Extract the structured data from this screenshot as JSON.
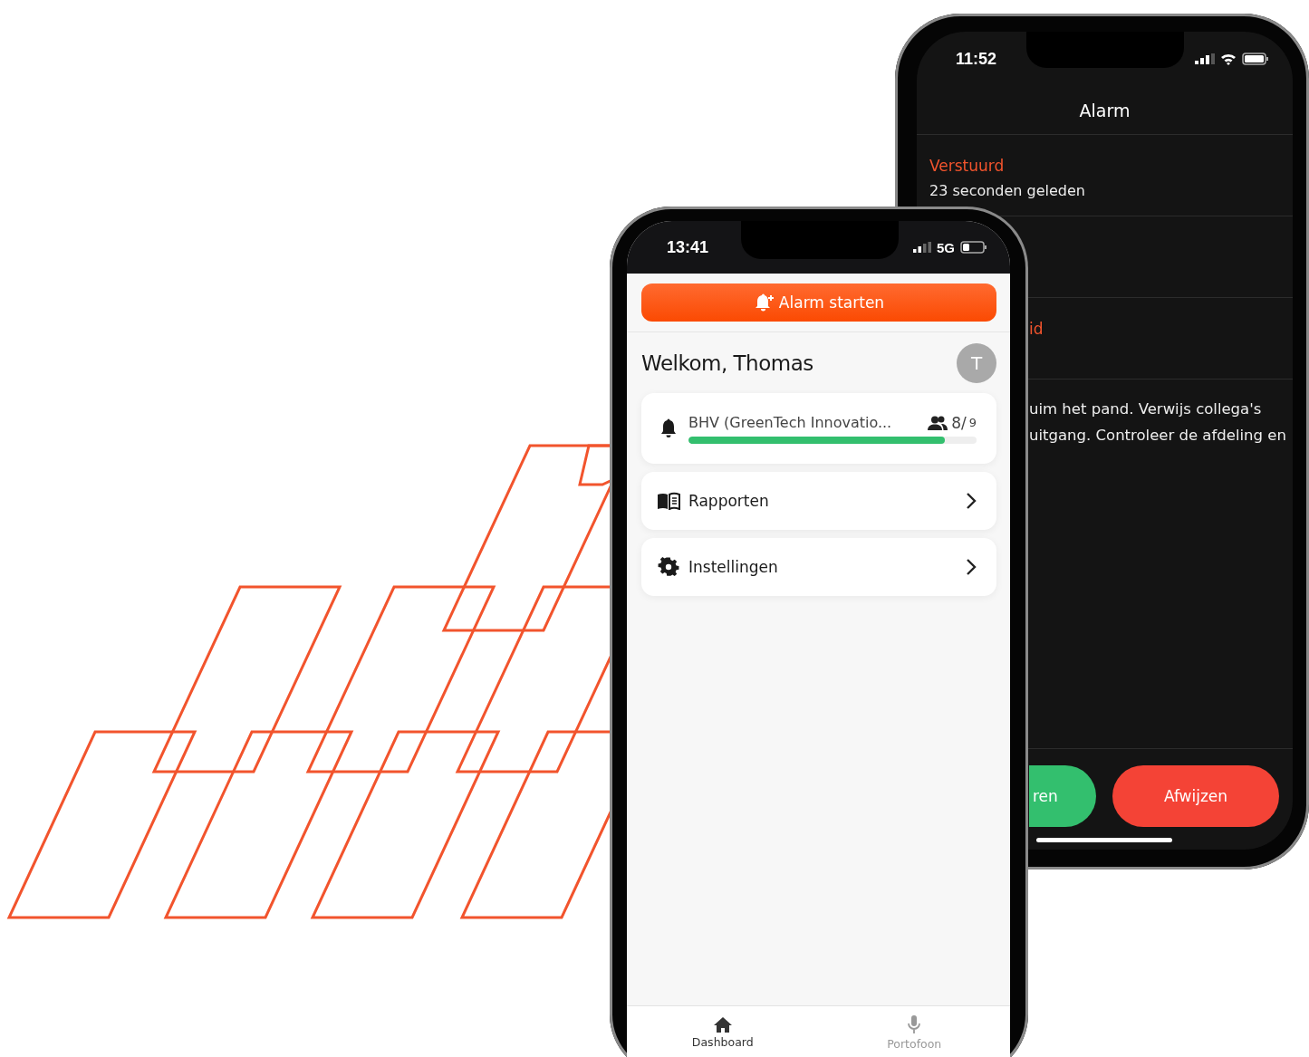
{
  "back_phone": {
    "status_bar": {
      "time": "11:52"
    },
    "title": "Alarm",
    "rows": [
      {
        "label": "Verstuurd",
        "value": "23 seconden geleden"
      },
      {
        "label": "id"
      }
    ],
    "message_lines": [
      "uim het pand. Verwijs collega's",
      "uitgang. Controleer de afdeling en"
    ],
    "buttons": [
      {
        "label": "ren",
        "kind": "accept"
      },
      {
        "label": "Afwijzen",
        "kind": "reject"
      }
    ]
  },
  "front_phone": {
    "status_bar": {
      "time": "13:41",
      "network": "5G"
    },
    "alarm_button": "Alarm starten",
    "welcome": "Welkom, Thomas",
    "avatar": "T",
    "group": {
      "name": "BHV (GreenTech Innovatio...",
      "count": "8/",
      "total": "9",
      "level": 0.89
    },
    "menu": [
      {
        "label": "Rapporten",
        "kind": "reports"
      },
      {
        "label": "Instellingen",
        "kind": "settings"
      }
    ],
    "tabs": [
      {
        "label": "Dashboard",
        "kind": "home",
        "selected": true
      },
      {
        "label": "Portofoon",
        "kind": "mic",
        "selected": false
      }
    ]
  }
}
